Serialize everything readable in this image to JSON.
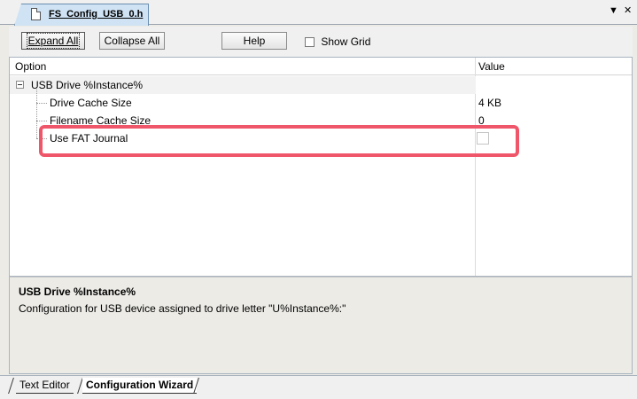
{
  "document_tab": {
    "title": "FS_Config_USB_0.h",
    "icon": "document-icon"
  },
  "window_controls": {
    "dropdown": "▼",
    "close": "✕"
  },
  "toolbar": {
    "expand_all": "Expand All",
    "collapse_all": "Collapse All",
    "help": "Help",
    "show_grid": "Show Grid",
    "show_grid_checked": false
  },
  "grid": {
    "columns": [
      "Option",
      "Value"
    ],
    "group": {
      "label": "USB Drive %Instance%",
      "expanded": true
    },
    "rows": [
      {
        "label": "Drive Cache Size",
        "value": "4 KB"
      },
      {
        "label": "Filename Cache Size",
        "value": "0"
      },
      {
        "label": "Use FAT Journal",
        "value_checked": false
      }
    ]
  },
  "description": {
    "title": "USB Drive %Instance%",
    "text": "Configuration for USB device assigned to drive letter \"U%Instance%:\""
  },
  "bottom_tabs": [
    {
      "label": "Text Editor",
      "active": false
    },
    {
      "label": "Configuration Wizard",
      "active": true
    }
  ],
  "colors": {
    "highlight": "#f0566a",
    "tab_active": "#cfe3f5"
  }
}
